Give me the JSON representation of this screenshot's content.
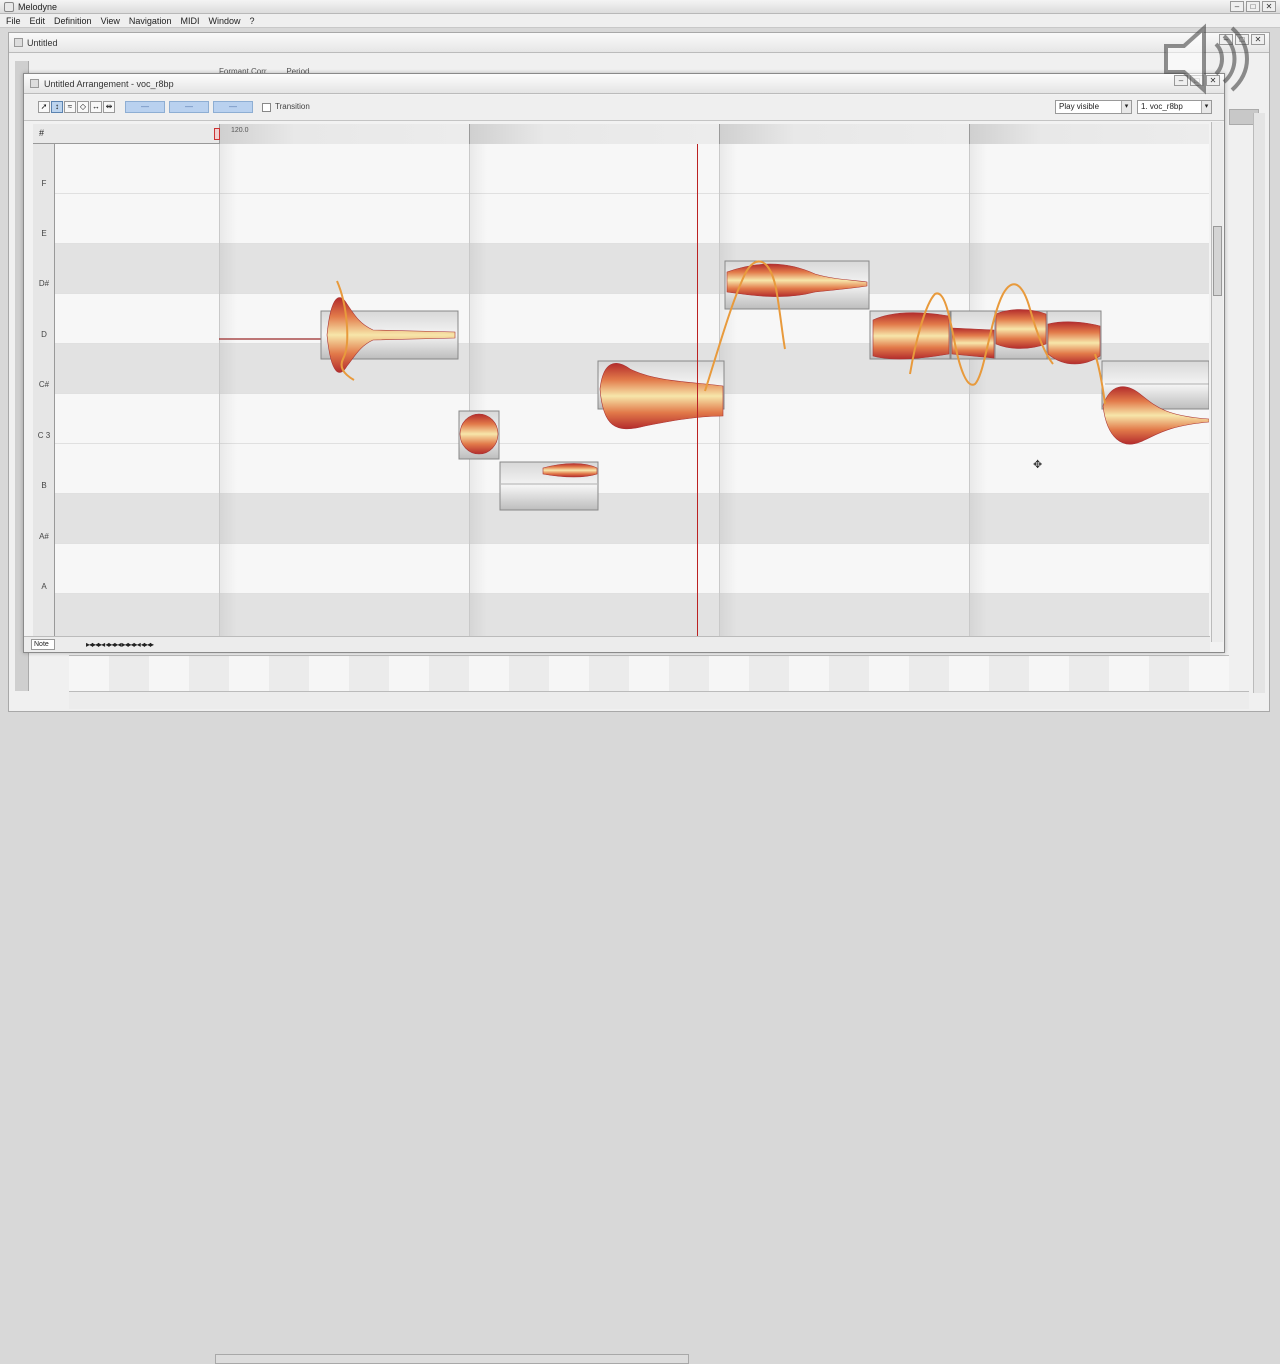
{
  "app": {
    "title": "Melodyne",
    "menu": [
      "File",
      "Edit",
      "Definition",
      "View",
      "Navigation",
      "MIDI",
      "Window",
      "?"
    ]
  },
  "doc_window": {
    "title": "Untitled",
    "behind_labels": [
      "Formant Corr.",
      "Period"
    ]
  },
  "arrangement": {
    "title": "Untitled Arrangement - voc_r8bp",
    "transition_label": "Transition",
    "macro_buttons": [
      "—",
      "—",
      "—"
    ],
    "dropdown_view": "Play visible",
    "dropdown_track": "1. voc_r8bp",
    "tempo_marker": "120.0",
    "bottom_mode": "Note"
  },
  "pitch_labels": [
    "F",
    "E",
    "D#",
    "D",
    "C#",
    "C 3",
    "B",
    "A#",
    "A"
  ],
  "window_controls": {
    "minimize": "–",
    "maximize": "□",
    "close": "✕"
  },
  "icons": {
    "pointer_tool": "pointer-tool-icon",
    "pitch_tool": "pitch-tool-icon",
    "formant_tool": "formant-tool-icon",
    "amplitude_tool": "amplitude-tool-icon",
    "timing_tool": "timing-tool-icon",
    "separation_tool": "separation-tool-icon",
    "speaker": "speaker-muted-icon"
  },
  "colors": {
    "blob_core": "#b32c2c",
    "blob_mid": "#e27a4a",
    "blob_edge": "#f5dfa0",
    "pitch_curve": "#e89a3c",
    "playhead": "#bb2222",
    "note_box": "#c8c8c8"
  }
}
